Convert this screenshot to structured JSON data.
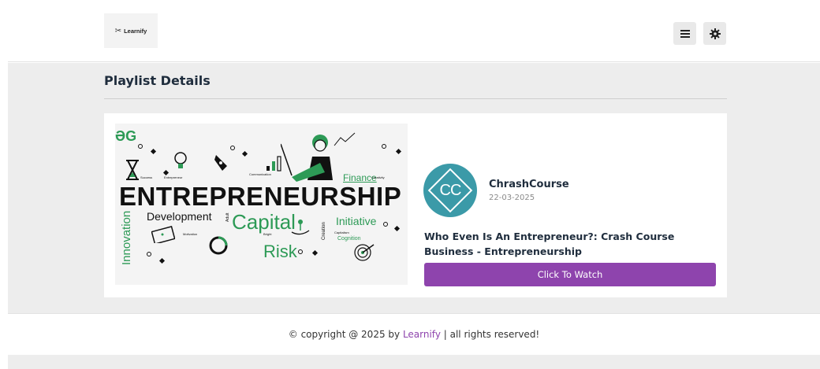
{
  "header": {
    "logo_text": "Learnify",
    "logo_icon": "scissors-icon",
    "menu_icon": "hamburger-icon",
    "theme_icon": "gear-icon"
  },
  "page": {
    "title": "Playlist Details"
  },
  "video": {
    "thumbnail": {
      "brand_mark": "ƏG",
      "headline": "ENTREPRENEURSHIP",
      "words": {
        "finance": "Finance",
        "creativity": "Creativity",
        "development": "Development",
        "capital": "Capital",
        "initiative": "Initiative",
        "innovation": "Innovation",
        "risk": "Risk",
        "cognition": "Cognition",
        "creation": "Creation",
        "communication": "Communication",
        "adult": "Adult",
        "bright": "Bright",
        "motivation": "Motivation",
        "success": "Success",
        "entrepreneur": "Entrepreneur",
        "capitalism": "Capitalism"
      }
    },
    "channel": {
      "avatar_text": "CC",
      "name": "ChrashCourse",
      "date": "22-03-2025"
    },
    "title": "Who Even Is An Entrepreneur?: Crash Course Business - Entrepreneurship",
    "watch_label": "Click To Watch"
  },
  "footer": {
    "prefix": "© copyright @ 2025 by ",
    "brand": "Learnify",
    "suffix": " | all rights reserved!"
  },
  "colors": {
    "accent": "#8e44ad",
    "avatar": "#3b9aa8",
    "thumbnail_green": "#2d9a56"
  }
}
